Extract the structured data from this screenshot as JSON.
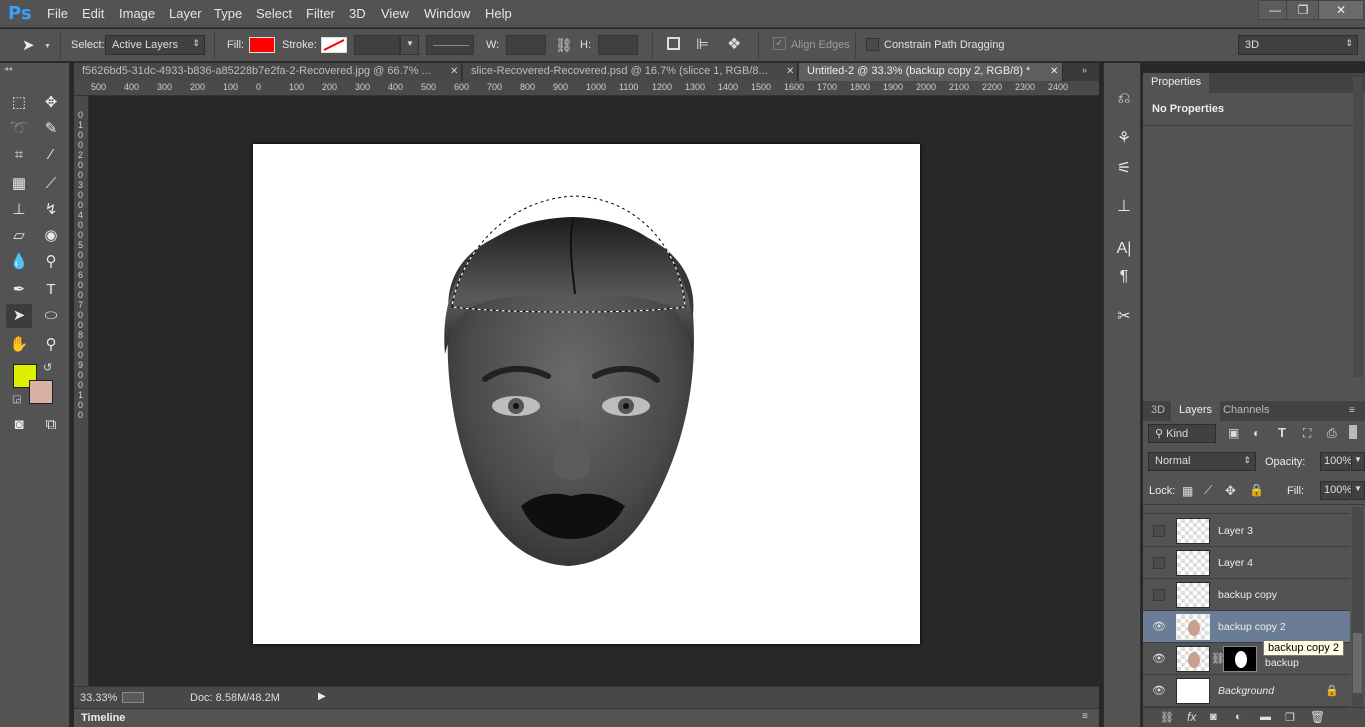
{
  "app": {
    "logo": "Ps"
  },
  "menu": [
    "File",
    "Edit",
    "Image",
    "Layer",
    "Type",
    "Select",
    "Filter",
    "3D",
    "View",
    "Window",
    "Help"
  ],
  "window_controls": {
    "minimize": "—",
    "restore": "❐",
    "close": "✕"
  },
  "options": {
    "select_label": "Select:",
    "select_value": "Active Layers",
    "fill_label": "Fill:",
    "fill_color": "#ff0000",
    "stroke_label": "Stroke:",
    "w_label": "W:",
    "h_label": "H:",
    "align_edges": "Align Edges",
    "constrain": "Constrain Path Dragging",
    "workspace": "3D"
  },
  "tabs": [
    {
      "label": "f5626bd5-31dc-4933-b836-a85228b7e2fa-2-Recovered.jpg @ 66.7% ...",
      "active": false
    },
    {
      "label": "slice-Recovered-Recovered.psd @ 16.7% (slicce 1, RGB/8...",
      "active": false
    },
    {
      "label": "Untitled-2 @ 33.3% (backup copy 2, RGB/8) *",
      "active": true
    }
  ],
  "ruler_h": [
    "500",
    "400",
    "300",
    "200",
    "100",
    "0",
    "100",
    "200",
    "300",
    "400",
    "500",
    "600",
    "700",
    "800",
    "900",
    "1000",
    "1100",
    "1200",
    "1300",
    "1400",
    "1500",
    "1600",
    "1700",
    "1800",
    "1900",
    "2000",
    "2100",
    "2200",
    "2300",
    "2400"
  ],
  "ruler_v": [
    "0",
    "1",
    "0",
    "0",
    "2",
    "0",
    "0",
    "3",
    "0",
    "0",
    "4",
    "0",
    "0",
    "5",
    "0",
    "0",
    "6",
    "0",
    "0",
    "7",
    "0",
    "0",
    "8",
    "0",
    "0",
    "9",
    "0",
    "0",
    "1",
    "0",
    "0"
  ],
  "colors": {
    "foreground": "#ddf000",
    "background": "#d9b0a4"
  },
  "status": {
    "zoom": "33.33%",
    "doc": "Doc: 8.58M/48.2M"
  },
  "timeline": {
    "label": "Timeline"
  },
  "properties": {
    "tab": "Properties",
    "content": "No Properties"
  },
  "layers_panel": {
    "tabs": [
      "3D",
      "Layers",
      "Channels"
    ],
    "active_tab": "Layers",
    "kind": "Kind",
    "blend": "Normal",
    "opacity_label": "Opacity:",
    "opacity": "100%",
    "lock_label": "Lock:",
    "fill_label": "Fill:",
    "fill": "100%",
    "layers": [
      {
        "name": "Layer 3",
        "visible": false,
        "selected": false
      },
      {
        "name": "Layer 4",
        "visible": false,
        "selected": false
      },
      {
        "name": "backup copy",
        "visible": false,
        "selected": false
      },
      {
        "name": "backup copy 2",
        "visible": true,
        "selected": true
      },
      {
        "name": "backup",
        "visible": true,
        "selected": false
      },
      {
        "name": "Background",
        "visible": true,
        "selected": false
      }
    ],
    "tooltip": "backup copy 2"
  }
}
